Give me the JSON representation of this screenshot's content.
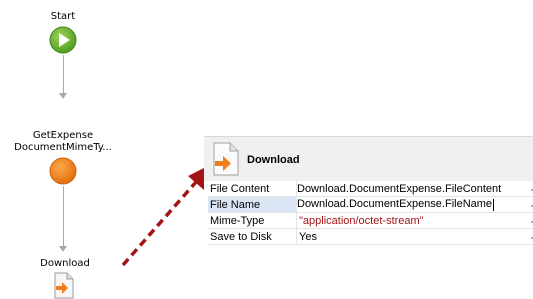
{
  "flow": {
    "start_label": "Start",
    "action_label_line1": "GetExpense",
    "action_label_line2": "DocumentMimeTy...",
    "download_label": "Download"
  },
  "panel": {
    "title": "Download",
    "properties": [
      {
        "name": "File Content",
        "value": "Download.DocumentExpense.FileContent"
      },
      {
        "name": "File Name",
        "value": "Download.DocumentExpense.FileName"
      },
      {
        "name": "Mime-Type",
        "value": "\"application/octet-stream\""
      },
      {
        "name": "Save to Disk",
        "value": "Yes"
      }
    ]
  },
  "colors": {
    "start_green": "#6cb233",
    "action_orange": "#f07c1b",
    "arrow_red": "#a31515",
    "download_icon_orange": "#f07c1b",
    "selected_row": "#dbe6f4",
    "string_value": "#a31515"
  },
  "icons": {
    "start": "play-icon",
    "action": "server-action-icon",
    "download": "download-document-icon",
    "callout": "dashed-arrow"
  }
}
